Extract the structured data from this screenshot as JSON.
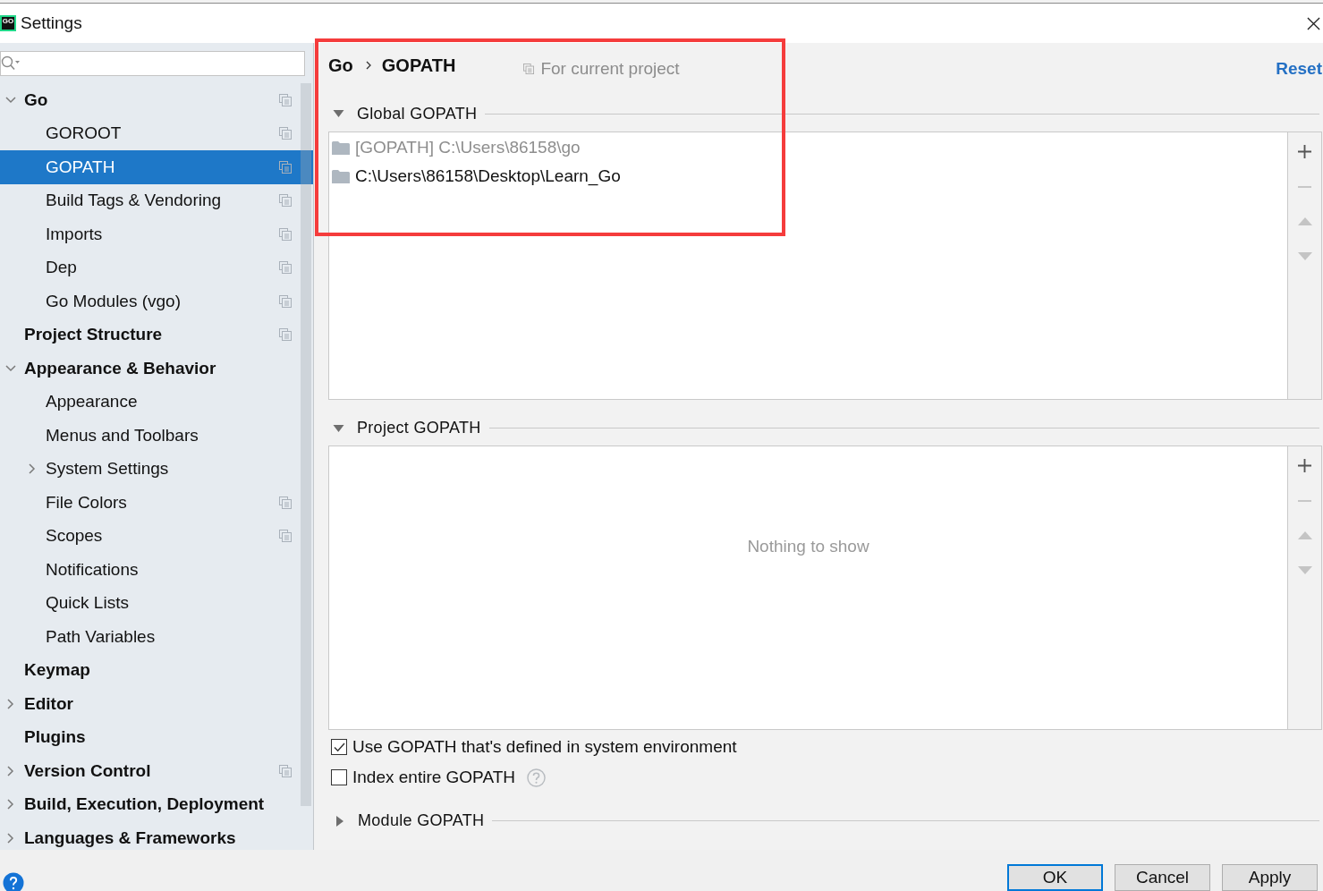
{
  "window": {
    "title": "Settings",
    "logo_text": "GO"
  },
  "sidebar": {
    "items": [
      {
        "label": "Go",
        "selected": false,
        "project_scoped": true,
        "expanded": true,
        "children": [
          {
            "label": "GOROOT",
            "selected": false,
            "project_scoped": true
          },
          {
            "label": "GOPATH",
            "selected": true,
            "project_scoped": true
          },
          {
            "label": "Build Tags & Vendoring",
            "selected": false,
            "project_scoped": true
          },
          {
            "label": "Imports",
            "selected": false,
            "project_scoped": true
          },
          {
            "label": "Dep",
            "selected": false,
            "project_scoped": true
          },
          {
            "label": "Go Modules (vgo)",
            "selected": false,
            "project_scoped": true
          }
        ]
      },
      {
        "label": "Project Structure",
        "selected": false,
        "project_scoped": true
      },
      {
        "label": "Appearance & Behavior",
        "selected": false,
        "project_scoped": false,
        "expanded": true,
        "children": [
          {
            "label": "Appearance",
            "selected": false,
            "project_scoped": false
          },
          {
            "label": "Menus and Toolbars",
            "selected": false,
            "project_scoped": false
          },
          {
            "label": "System Settings",
            "selected": false,
            "project_scoped": false,
            "expanded": false
          },
          {
            "label": "File Colors",
            "selected": false,
            "project_scoped": true
          },
          {
            "label": "Scopes",
            "selected": false,
            "project_scoped": true
          },
          {
            "label": "Notifications",
            "selected": false,
            "project_scoped": false
          },
          {
            "label": "Quick Lists",
            "selected": false,
            "project_scoped": false
          },
          {
            "label": "Path Variables",
            "selected": false,
            "project_scoped": false
          }
        ]
      },
      {
        "label": "Keymap",
        "selected": false,
        "project_scoped": false
      },
      {
        "label": "Editor",
        "selected": false,
        "project_scoped": false,
        "expanded": false
      },
      {
        "label": "Plugins",
        "selected": false,
        "project_scoped": false
      },
      {
        "label": "Version Control",
        "selected": false,
        "project_scoped": true,
        "expanded": false
      },
      {
        "label": "Build, Execution, Deployment",
        "selected": false,
        "project_scoped": false,
        "expanded": false
      },
      {
        "label": "Languages & Frameworks",
        "selected": false,
        "project_scoped": false,
        "expanded": false
      }
    ]
  },
  "breadcrumb": [
    "Go",
    "GOPATH"
  ],
  "scope_hint": "For current project",
  "reset_link": "Reset",
  "global_gopath": {
    "title": "Global GOPATH",
    "expanded": true,
    "entries": [
      {
        "path": "[GOPATH] C:\\Users\\86158\\go",
        "disabled": true
      },
      {
        "path": "C:\\Users\\86158\\Desktop\\Learn_Go",
        "disabled": false
      }
    ],
    "toolbar": [
      {
        "kind": "add",
        "disabled": false
      },
      {
        "kind": "remove",
        "disabled": true
      },
      {
        "kind": "up",
        "disabled": true
      },
      {
        "kind": "down",
        "disabled": true
      }
    ]
  },
  "project_gopath": {
    "title": "Project GOPATH",
    "expanded": true,
    "empty_text": "Nothing to show",
    "toolbar": [
      {
        "kind": "add",
        "disabled": false
      },
      {
        "kind": "remove",
        "disabled": true
      },
      {
        "kind": "up",
        "disabled": true
      },
      {
        "kind": "down",
        "disabled": true
      }
    ]
  },
  "options": [
    {
      "label": "Use GOPATH that's defined in system environment",
      "checked": true,
      "help": false
    },
    {
      "label": "Index entire GOPATH",
      "checked": false,
      "help": true
    }
  ],
  "module_gopath": {
    "title": "Module GOPATH",
    "expanded": false
  },
  "buttons": [
    {
      "label": "OK",
      "default": true
    },
    {
      "label": "Cancel",
      "default": false
    },
    {
      "label": "Apply",
      "default": false
    }
  ],
  "annotation": {
    "kind": "rectangle"
  }
}
